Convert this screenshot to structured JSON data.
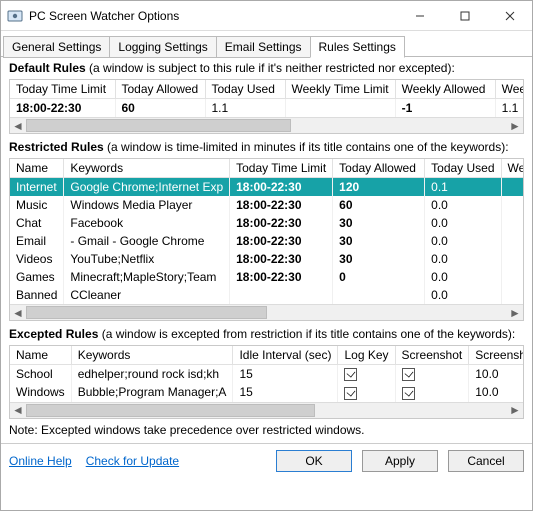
{
  "window": {
    "title": "PC Screen Watcher Options"
  },
  "tabs": {
    "general": "General Settings",
    "logging": "Logging Settings",
    "email": "Email Settings",
    "rules": "Rules Settings"
  },
  "default_rules": {
    "heading": "Default Rules",
    "desc": " (a window is subject to this rule if it's neither restricted nor excepted):",
    "columns": [
      "Today Time Limit",
      "Today Allowed",
      "Today Used",
      "Weekly Time Limit",
      "Weekly Allowed",
      "Weekly U"
    ],
    "row": {
      "today_time_limit": "18:00-22:30",
      "today_allowed": "60",
      "today_used": "1.1",
      "weekly_time_limit": "",
      "weekly_allowed": "-1",
      "weekly_u": "1.1"
    }
  },
  "restricted": {
    "heading": "Restricted Rules",
    "desc": " (a window is time-limited in minutes if its title contains one of the keywords):",
    "columns": [
      "Name",
      "Keywords",
      "Today Time Limit",
      "Today Allowed",
      "Today Used",
      "Weekly Ti"
    ],
    "rows": [
      {
        "name": "Internet",
        "keywords": "Google Chrome;Internet Exp",
        "limit": "18:00-22:30",
        "allowed": "120",
        "used": "0.1",
        "selected": true
      },
      {
        "name": "Music",
        "keywords": "Windows Media Player",
        "limit": "18:00-22:30",
        "allowed": "60",
        "used": "0.0"
      },
      {
        "name": "Chat",
        "keywords": "Facebook",
        "limit": "18:00-22:30",
        "allowed": "30",
        "used": "0.0"
      },
      {
        "name": "Email",
        "keywords": "- Gmail - Google Chrome",
        "limit": "18:00-22:30",
        "allowed": "30",
        "used": "0.0"
      },
      {
        "name": "Videos",
        "keywords": "YouTube;Netflix",
        "limit": "18:00-22:30",
        "allowed": "30",
        "used": "0.0"
      },
      {
        "name": "Games",
        "keywords": "Minecraft;MapleStory;Team",
        "limit": "18:00-22:30",
        "allowed": "0",
        "used": "0.0"
      },
      {
        "name": "Banned",
        "keywords": "CCleaner",
        "limit": "",
        "allowed": "",
        "used": "0.0"
      }
    ]
  },
  "excepted": {
    "heading": "Excepted Rules",
    "desc": " (a window is excepted from restriction if its title contains one of the keywords):",
    "columns": [
      "Name",
      "Keywords",
      "Idle Interval (sec)",
      "Log Key",
      "Screenshot",
      "Screenshot Inter"
    ],
    "rows": [
      {
        "name": "School",
        "keywords": "edhelper;round rock isd;kh",
        "idle": "15",
        "logkey": true,
        "screenshot": true,
        "sinterval": "10.0"
      },
      {
        "name": "Windows",
        "keywords": "Bubble;Program Manager;A",
        "idle": "15",
        "logkey": true,
        "screenshot": true,
        "sinterval": "10.0"
      }
    ]
  },
  "note": "Note: Excepted windows take precedence over restricted windows.",
  "footer": {
    "online_help": "Online Help",
    "check_update": "Check for Update",
    "ok": "OK",
    "apply": "Apply",
    "cancel": "Cancel"
  }
}
